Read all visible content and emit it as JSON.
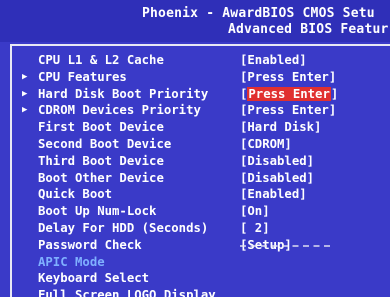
{
  "header": {
    "title_line1": "Phoenix - AwardBIOS CMOS Setu",
    "title_line2": "Advanced BIOS Featur"
  },
  "menu": [
    {
      "label": "CPU L1 & L2 Cache",
      "value": "[Enabled]",
      "submenu": false
    },
    {
      "label": "CPU Features",
      "value": "[Press Enter]",
      "submenu": true
    },
    {
      "label": "Hard Disk Boot Priority",
      "value": "[Press Enter]",
      "submenu": true,
      "selected": true
    },
    {
      "label": "CDROM Devices Priority",
      "value": "[Press Enter]",
      "submenu": true
    },
    {
      "label": "First Boot Device",
      "value": "[Hard Disk]",
      "submenu": false
    },
    {
      "label": "Second Boot Device",
      "value": "[CDROM]",
      "submenu": false
    },
    {
      "label": "Third Boot Device",
      "value": "[Disabled]",
      "submenu": false
    },
    {
      "label": "Boot Other Device",
      "value": "[Disabled]",
      "submenu": false
    },
    {
      "label": "Quick Boot",
      "value": "[Enabled]",
      "submenu": false
    },
    {
      "label": "Boot Up Num-Lock",
      "value": "[On]",
      "submenu": false
    },
    {
      "label": "Delay For HDD (Seconds)",
      "value": "[ 2]",
      "submenu": false
    },
    {
      "label": "Password Check",
      "value": "[Setup]",
      "submenu": false
    },
    {
      "label": "APIC Mode",
      "value": "",
      "submenu": false,
      "dim": true
    },
    {
      "label": "Keyboard Select",
      "value": "",
      "submenu": false
    },
    {
      "label": "Full Screen LOGO Display",
      "value": "",
      "submenu": false
    }
  ],
  "colors": {
    "background": "#3a3ac8",
    "text": "#ffffff",
    "highlight": "#e03030",
    "dim_text": "#7fb0ff"
  },
  "icons": {
    "submenu": "triangle-right-icon"
  }
}
